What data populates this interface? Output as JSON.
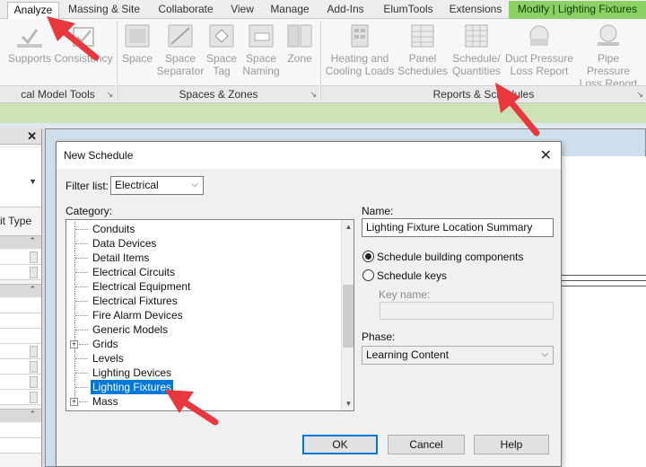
{
  "ribbon": {
    "tabs": [
      {
        "label": "Analyze"
      },
      {
        "label": "Massing & Site"
      },
      {
        "label": "Collaborate"
      },
      {
        "label": "View"
      },
      {
        "label": "Manage"
      },
      {
        "label": "Add-Ins"
      },
      {
        "label": "ElumTools"
      },
      {
        "label": "Extensions"
      },
      {
        "label": "Modify | Lighting Fixtures"
      }
    ],
    "tools": [
      {
        "label": "Supports",
        "icon": "supports-icon"
      },
      {
        "label": "Consistency",
        "icon": "consistency-icon"
      },
      {
        "label": "Space",
        "icon": "space-icon"
      },
      {
        "label": "Space\nSeparator",
        "icon": "space-separator-icon"
      },
      {
        "label": "Space\nTag",
        "icon": "space-tag-icon"
      },
      {
        "label": "Space\nNaming",
        "icon": "space-naming-icon"
      },
      {
        "label": "Zone",
        "icon": "zone-icon"
      },
      {
        "label": "Heating and\nCooling Loads",
        "icon": "heating-cooling-icon"
      },
      {
        "label": "Panel\nSchedules",
        "icon": "panel-schedules-icon"
      },
      {
        "label": "Schedule/\nQuantities",
        "icon": "schedule-quantities-icon"
      },
      {
        "label": "Duct Pressure\nLoss Report",
        "icon": "duct-pressure-icon"
      },
      {
        "label": "Pipe Pressure\nLoss Report",
        "icon": "pipe-pressure-icon"
      }
    ],
    "panels": [
      {
        "label": "cal Model Tools"
      },
      {
        "label": "Spaces & Zones"
      },
      {
        "label": "Reports & Schedules"
      }
    ]
  },
  "properties": {
    "close_label": "✕",
    "type_label": "it Type"
  },
  "dialog": {
    "title": "New Schedule",
    "close_label": "✕",
    "filter_label": "Filter list:",
    "filter_value": "Electrical",
    "category_label": "Category:",
    "categories": [
      {
        "label": "Conduits",
        "expandable": false,
        "selected": false
      },
      {
        "label": "Data Devices",
        "expandable": false,
        "selected": false
      },
      {
        "label": "Detail Items",
        "expandable": false,
        "selected": false
      },
      {
        "label": "Electrical Circuits",
        "expandable": false,
        "selected": false
      },
      {
        "label": "Electrical Equipment",
        "expandable": false,
        "selected": false
      },
      {
        "label": "Electrical Fixtures",
        "expandable": false,
        "selected": false
      },
      {
        "label": "Fire Alarm Devices",
        "expandable": false,
        "selected": false
      },
      {
        "label": "Generic Models",
        "expandable": false,
        "selected": false
      },
      {
        "label": "Grids",
        "expandable": true,
        "selected": false
      },
      {
        "label": "Levels",
        "expandable": false,
        "selected": false
      },
      {
        "label": "Lighting Devices",
        "expandable": false,
        "selected": false
      },
      {
        "label": "Lighting Fixtures",
        "expandable": false,
        "selected": true
      },
      {
        "label": "Mass",
        "expandable": true,
        "selected": false
      }
    ],
    "name_label": "Name:",
    "name_value": "Lighting Fixture Location Summary",
    "radio_components": "Schedule building components",
    "radio_keys": "Schedule keys",
    "key_name_label": "Key name:",
    "key_name_value": "",
    "phase_label": "Phase:",
    "phase_value": "Learning Content",
    "ok_label": "OK",
    "cancel_label": "Cancel",
    "help_label": "Help"
  },
  "colors": {
    "context_tab": "#8bd163",
    "selection": "#0078d7",
    "annotation_arrow": "#e8383d"
  }
}
